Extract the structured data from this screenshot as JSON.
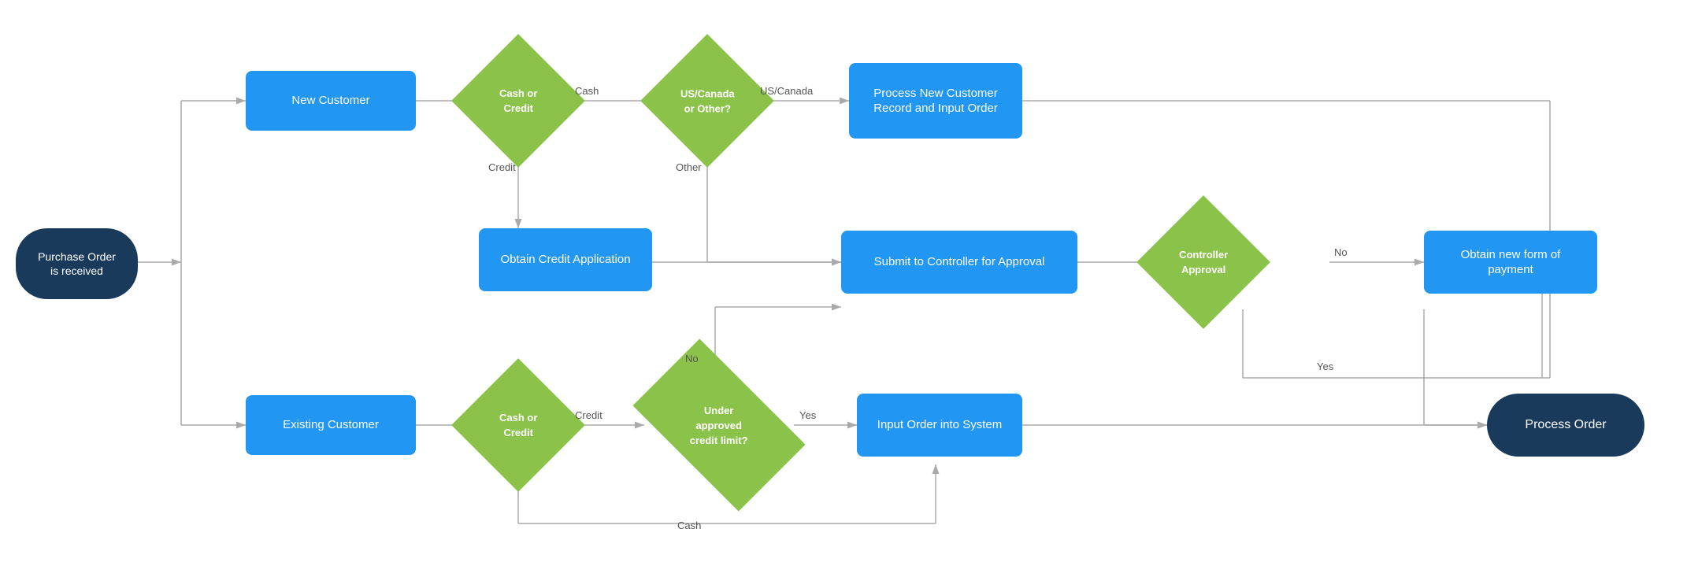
{
  "nodes": {
    "purchase_order": {
      "label": "Purchase Order\nis received"
    },
    "new_customer": {
      "label": "New Customer"
    },
    "existing_customer": {
      "label": "Existing Customer"
    },
    "cash_credit_new": {
      "label": "Cash or\nCredit"
    },
    "cash_credit_existing": {
      "label": "Cash or\nCredit"
    },
    "us_canada": {
      "label": "US/Canada\nor Other?"
    },
    "under_limit": {
      "label": "Under\napproved\ncredit limit?"
    },
    "obtain_credit": {
      "label": "Obtain Credit\nApplication"
    },
    "submit_controller": {
      "label": "Submit to Controller\nfor Approval"
    },
    "controller_approval": {
      "label": "Controller\nApproval"
    },
    "process_new_customer": {
      "label": "Process New\nCustomer Record\nand Input Order"
    },
    "input_order": {
      "label": "Input Order into\nSystem"
    },
    "obtain_payment": {
      "label": "Obtain new form of\npayment"
    },
    "process_order": {
      "label": "Process Order"
    }
  },
  "labels": {
    "cash": "Cash",
    "credit": "Credit",
    "us_canada": "US/Canada",
    "other": "Other",
    "no": "No",
    "yes": "Yes",
    "cash2": "Cash"
  }
}
